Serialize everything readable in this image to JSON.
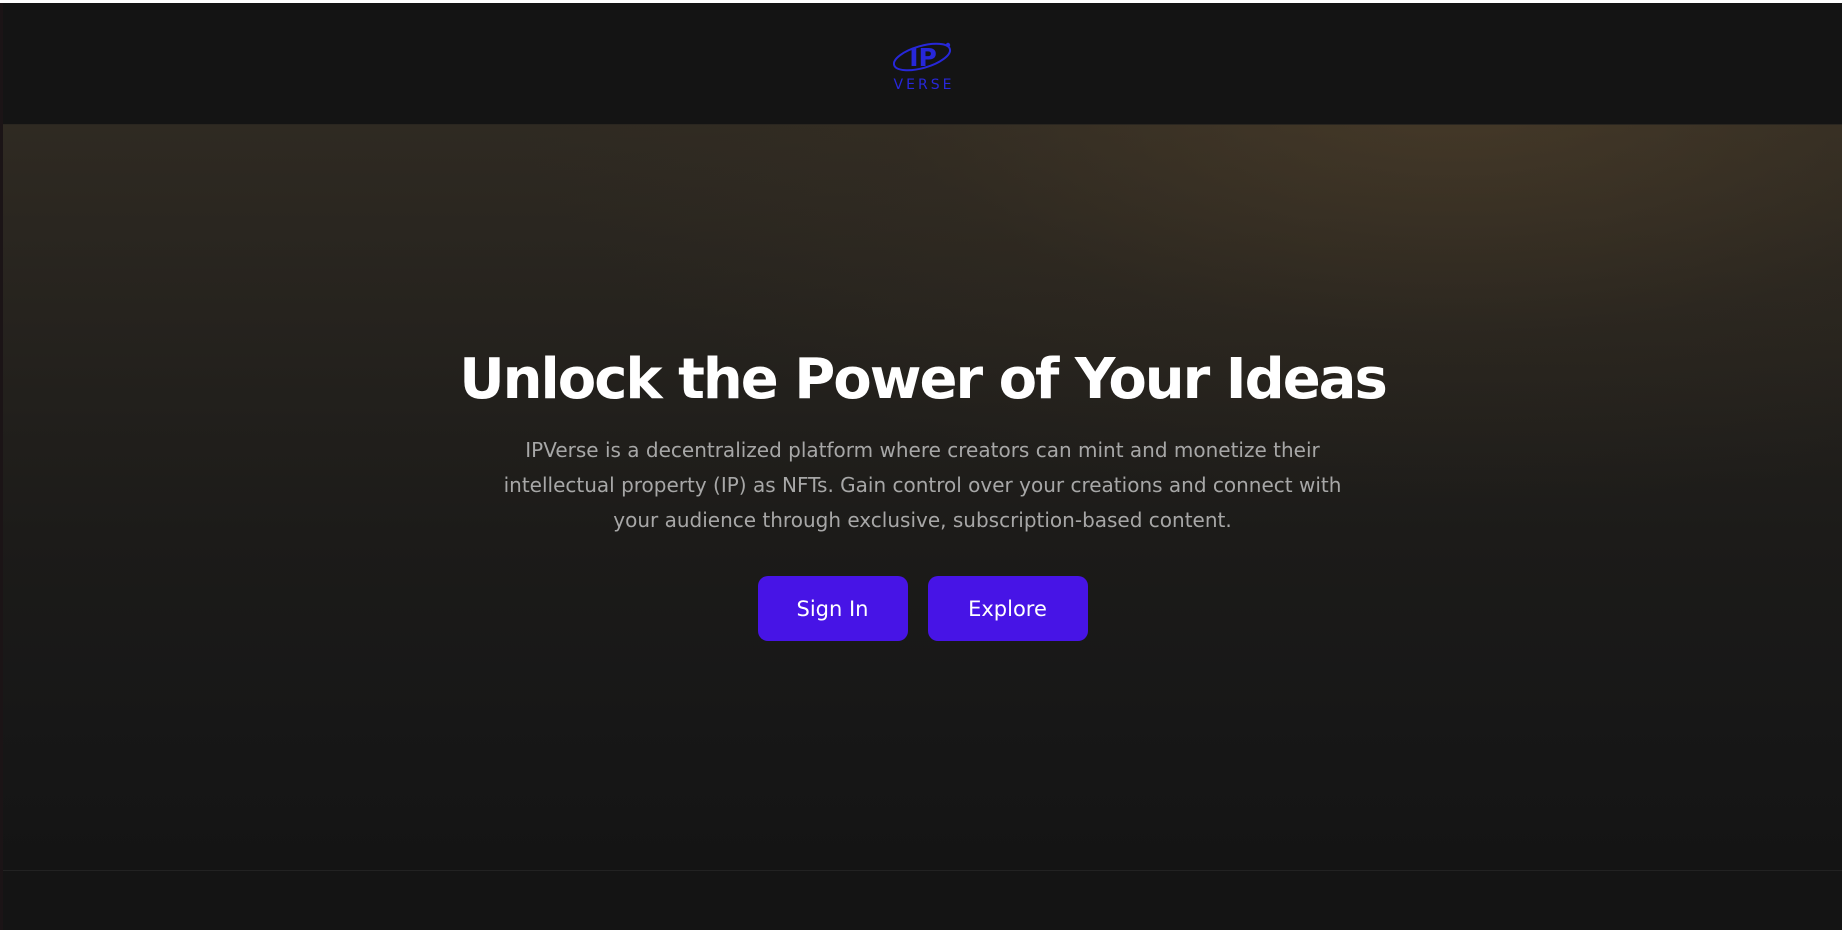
{
  "brand": {
    "logo_initials": "IP",
    "logo_word": "VERSE",
    "logo_color": "#2727d9"
  },
  "hero": {
    "title": "Unlock the Power of Your Ideas",
    "description": "IPVerse is a decentralized platform where creators can mint and monetize their intellectual property (IP) as NFTs. Gain control over your creations and connect with your audience through exclusive, subscription-based content."
  },
  "actions": {
    "sign_in_label": "Sign In",
    "explore_label": "Explore",
    "button_color": "#4714e6"
  },
  "theme": {
    "background": "#141414",
    "title_color": "#ffffff",
    "description_color": "#a7a7a7"
  }
}
